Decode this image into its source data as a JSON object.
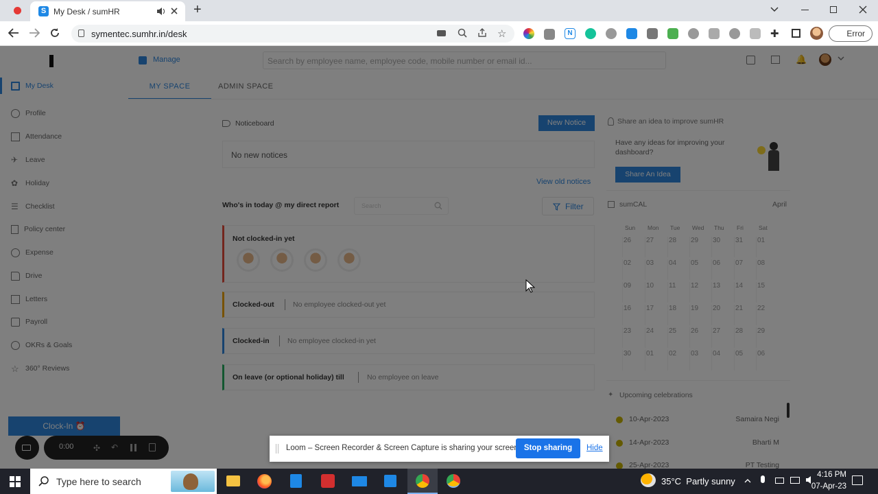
{
  "browser": {
    "tab_title": "My Desk / sumHR",
    "new_tab_label": "+",
    "url": "symentec.sumhr.in/desk",
    "error_label": "Error"
  },
  "header": {
    "manage_label": "Manage",
    "search_placeholder": "Search by employee name, employee code, mobile number or email id..."
  },
  "tabs": [
    {
      "label": "MY SPACE"
    },
    {
      "label": "ADMIN SPACE"
    }
  ],
  "sidebar": {
    "items": [
      {
        "label": "My Desk",
        "icon": "desktop-icon"
      },
      {
        "label": "Profile",
        "icon": "person-icon"
      },
      {
        "label": "Attendance",
        "icon": "calendar-icon"
      },
      {
        "label": "Leave",
        "icon": "plane-icon"
      },
      {
        "label": "Holiday",
        "icon": "palm-icon"
      },
      {
        "label": "Checklist",
        "icon": "checklist-icon"
      },
      {
        "label": "Policy center",
        "icon": "document-icon"
      },
      {
        "label": "Expense",
        "icon": "coins-icon"
      },
      {
        "label": "Drive",
        "icon": "folder-icon"
      },
      {
        "label": "Letters",
        "icon": "letter-icon"
      },
      {
        "label": "Payroll",
        "icon": "payroll-icon"
      },
      {
        "label": "OKRs & Goals",
        "icon": "target-icon"
      },
      {
        "label": "360° Reviews",
        "icon": "star-icon"
      }
    ],
    "clock_in_label": "Clock-In"
  },
  "noticeboard": {
    "title": "Noticeboard",
    "new_notice_label": "New Notice",
    "empty_text": "No new notices",
    "view_old_label": "View old notices"
  },
  "whos_in": {
    "title": "Who's in today @ my direct report",
    "search_placeholder": "Search",
    "filter_label": "Filter",
    "groups": [
      {
        "label": "Not clocked-in yet",
        "status": "",
        "color": "#e74c3c"
      },
      {
        "label": "Clocked-out",
        "status": "No employee clocked-out yet",
        "color": "#f0a500"
      },
      {
        "label": "Clocked-in",
        "status": "No employee clocked-in yet",
        "color": "#2e86de"
      },
      {
        "label": "On leave (or optional holiday) till",
        "status": "No employee on leave",
        "color": "#27ae60"
      }
    ]
  },
  "idea": {
    "title": "Share an idea to improve sumHR",
    "text": "Have any ideas for improving your dashboard?",
    "button_label": "Share An Idea"
  },
  "calendar": {
    "title": "sumCAL",
    "month": "April",
    "weekdays": [
      "Sun",
      "Mon",
      "Tue",
      "Wed",
      "Thu",
      "Fri",
      "Sat"
    ],
    "weeks": [
      [
        "26",
        "27",
        "28",
        "29",
        "30",
        "31",
        "01"
      ],
      [
        "02",
        "03",
        "04",
        "05",
        "06",
        "07",
        "08"
      ],
      [
        "09",
        "10",
        "11",
        "12",
        "13",
        "14",
        "15"
      ],
      [
        "16",
        "17",
        "18",
        "19",
        "20",
        "21",
        "22"
      ],
      [
        "23",
        "24",
        "25",
        "26",
        "27",
        "28",
        "29"
      ],
      [
        "30",
        "01",
        "02",
        "03",
        "04",
        "05",
        "06"
      ]
    ]
  },
  "celebrations": {
    "title": "Upcoming celebrations",
    "items": [
      {
        "date": "10-Apr-2023",
        "name": "Samaira Negi"
      },
      {
        "date": "14-Apr-2023",
        "name": "Bharti M"
      },
      {
        "date": "25-Apr-2023",
        "name": "PT Testing"
      }
    ]
  },
  "recorder": {
    "time": "0:00"
  },
  "loom": {
    "message": "Loom – Screen Recorder & Screen Capture is sharing your screen.",
    "stop_label": "Stop sharing",
    "hide_label": "Hide"
  },
  "taskbar": {
    "search_placeholder": "Type here to search",
    "weather": "35°C  Partly sunny",
    "time": "4:16 PM",
    "date": "07-Apr-23"
  },
  "colors": {
    "accent": "#1a73e8",
    "brand_blue": "#2e86de",
    "loom_blue": "#1a73e8"
  }
}
